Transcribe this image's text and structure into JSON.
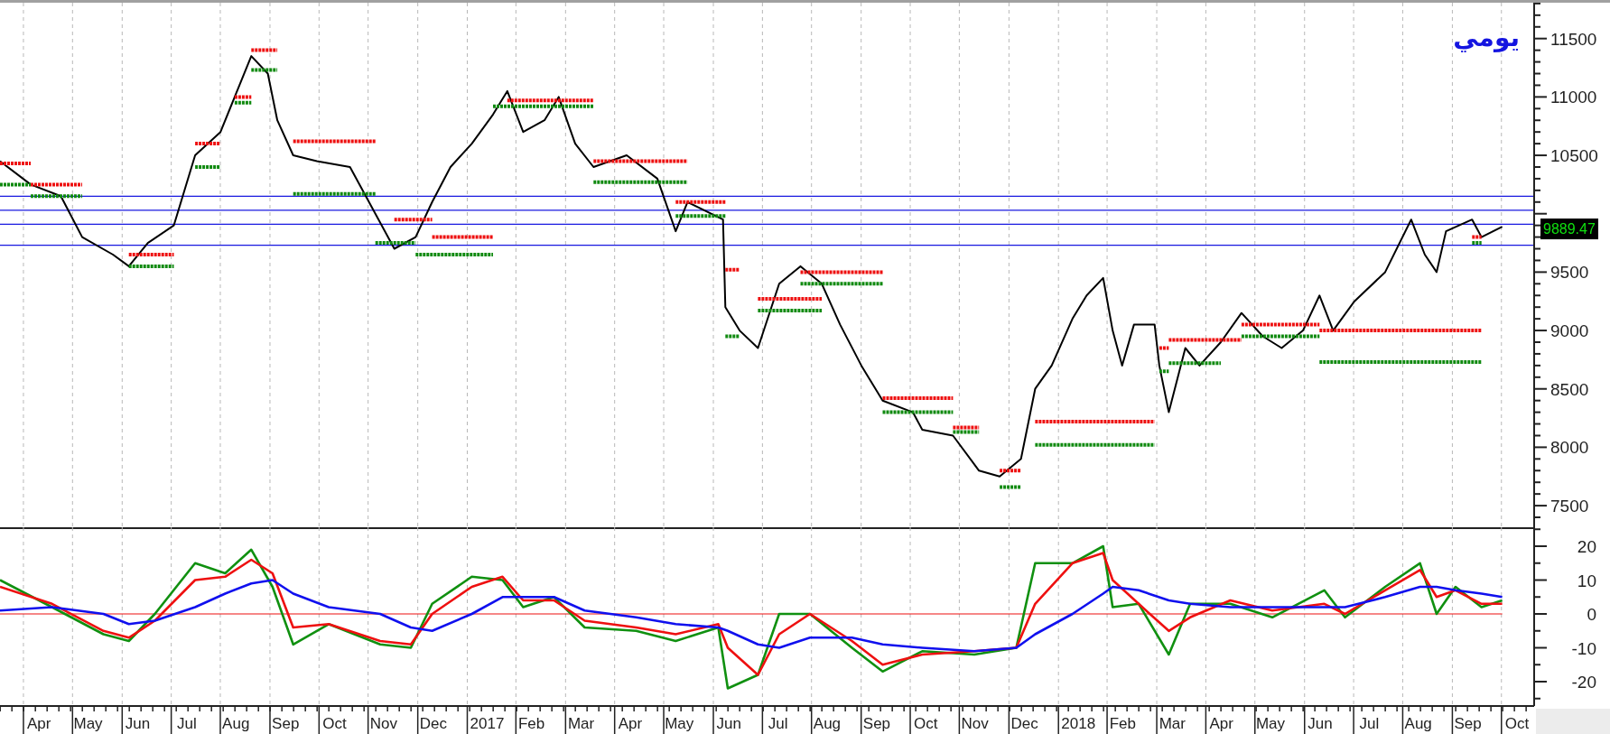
{
  "price_chart": {
    "chart_data": {
      "type": "line",
      "title": "يومي",
      "xlim": [
        2016.21,
        2018.805
      ],
      "ylim": [
        7315,
        11807
      ],
      "yticks": [
        7500,
        8000,
        8500,
        9000,
        9500,
        10500,
        11000,
        11500
      ],
      "x": [
        2016.21,
        2016.262,
        2016.313,
        2016.349,
        2016.401,
        2016.428,
        2016.46,
        2016.504,
        2016.54,
        2016.583,
        2016.607,
        2016.635,
        2016.663,
        2016.679,
        2016.706,
        2016.746,
        2016.802,
        2016.845,
        2016.877,
        2016.913,
        2016.941,
        2016.972,
        2017.008,
        2017.044,
        2017.068,
        2017.095,
        2017.131,
        2017.155,
        2017.183,
        2017.214,
        2017.27,
        2017.322,
        2017.353,
        2017.373,
        2017.433,
        2017.437,
        2017.461,
        2017.492,
        2017.528,
        2017.564,
        2017.6,
        2017.631,
        2017.667,
        2017.703,
        2017.754,
        2017.77,
        2017.822,
        2017.866,
        2017.901,
        2017.937,
        2017.961,
        2017.989,
        2018.024,
        2018.048,
        2018.076,
        2018.092,
        2018.108,
        2018.128,
        2018.163,
        2018.171,
        2018.187,
        2018.215,
        2018.239,
        2018.275,
        2018.31,
        2018.346,
        2018.378,
        2018.414,
        2018.442,
        2018.465,
        2018.501,
        2018.553,
        2018.597,
        2018.62,
        2018.64,
        2018.656,
        2018.7,
        2018.716,
        2018.751
      ],
      "series": [
        {
          "color": "#000000",
          "values": [
            10450,
            10250,
            10150,
            9800,
            9650,
            9550,
            9750,
            9900,
            10500,
            10700,
            11000,
            11350,
            11200,
            10800,
            10500,
            10450,
            10400,
            10000,
            9700,
            9800,
            10100,
            10400,
            10600,
            10850,
            11050,
            10700,
            10800,
            11000,
            10600,
            10400,
            10500,
            10300,
            9850,
            10100,
            9950,
            9200,
            9000,
            8850,
            9400,
            9550,
            9400,
            9050,
            8700,
            8400,
            8300,
            8150,
            8100,
            7800,
            7750,
            7900,
            8500,
            8700,
            9100,
            9300,
            9450,
            9000,
            8700,
            9050,
            9050,
            8700,
            8300,
            8850,
            8700,
            8900,
            9150,
            8950,
            8850,
            9000,
            9300,
            9000,
            9250,
            9500,
            9950,
            9650,
            9500,
            9850,
            9950,
            9800,
            9889
          ]
        },
        {
          "color": "#ee1010",
          "line_style": "dotted",
          "values": [
            10430,
            10430,
            null,
            null,
            null,
            9650,
            9650,
            9650,
            null,
            null,
            11000,
            11000,
            null,
            null,
            10620,
            10620,
            10620,
            10620,
            null,
            null,
            9800,
            9800,
            9800,
            9800,
            null,
            null,
            null,
            null,
            null,
            10450,
            10450,
            10450,
            10450,
            10450,
            null,
            9520,
            9520,
            null,
            null,
            9500,
            9500,
            9500,
            9500,
            9500,
            null,
            null,
            8170,
            8170,
            null,
            null,
            8220,
            8220,
            8220,
            8220,
            8220,
            8220,
            8220,
            8220,
            8220,
            null,
            8920,
            8920,
            8920,
            8920,
            8920,
            null,
            null,
            null,
            9000,
            9000,
            9000,
            9000,
            9000,
            9000,
            9000,
            9000,
            9000,
            9000,
            null
          ]
        },
        {
          "color": "#ee1010",
          "line_style": "dotted",
          "values": [
            null,
            10250,
            10250,
            10250,
            null,
            null,
            null,
            null,
            10600,
            10600,
            null,
            11400,
            11400,
            11400,
            null,
            null,
            null,
            null,
            9950,
            9950,
            9950,
            null,
            null,
            null,
            10970,
            10970,
            10970,
            10970,
            10970,
            10970,
            null,
            null,
            10100,
            10100,
            10100,
            10100,
            null,
            9270,
            9270,
            9270,
            9270,
            null,
            null,
            8420,
            8420,
            8420,
            8420,
            null,
            7800,
            7800,
            null,
            null,
            null,
            null,
            null,
            null,
            null,
            null,
            null,
            8850,
            8850,
            null,
            null,
            null,
            9050,
            9050,
            9050,
            9050,
            9050,
            null,
            null,
            null,
            null,
            null,
            null,
            null,
            9800,
            9800,
            null
          ]
        },
        {
          "color": "#108a10",
          "line_style": "dotted",
          "values": [
            10250,
            10250,
            null,
            null,
            null,
            9550,
            9550,
            9550,
            null,
            null,
            10950,
            10950,
            null,
            null,
            10170,
            10170,
            10170,
            10170,
            null,
            9650,
            9650,
            9650,
            9650,
            9650,
            null,
            null,
            null,
            null,
            null,
            10270,
            10270,
            10270,
            10270,
            10270,
            null,
            8950,
            8950,
            null,
            null,
            9400,
            9400,
            9400,
            9400,
            9400,
            null,
            null,
            8130,
            8130,
            null,
            null,
            8020,
            8020,
            8020,
            8020,
            8020,
            8020,
            8020,
            8020,
            8020,
            null,
            8720,
            8720,
            8720,
            8720,
            null,
            null,
            null,
            null,
            8730,
            8730,
            8730,
            8730,
            8730,
            8730,
            8730,
            8730,
            8730,
            8730,
            null
          ]
        },
        {
          "color": "#108a10",
          "line_style": "dotted",
          "values": [
            null,
            10150,
            10150,
            10150,
            null,
            null,
            null,
            null,
            10400,
            10400,
            null,
            11230,
            11230,
            11230,
            null,
            null,
            null,
            9750,
            9750,
            9750,
            null,
            null,
            null,
            10920,
            10920,
            10920,
            10920,
            10920,
            10920,
            10920,
            null,
            null,
            9980,
            9980,
            9980,
            9980,
            null,
            9170,
            9170,
            9170,
            9170,
            null,
            null,
            8300,
            8300,
            8300,
            8300,
            null,
            7660,
            7660,
            null,
            null,
            null,
            null,
            null,
            null,
            null,
            null,
            null,
            8650,
            8650,
            null,
            null,
            null,
            8950,
            8950,
            8950,
            8950,
            8950,
            null,
            null,
            null,
            null,
            null,
            null,
            null,
            9750,
            9750,
            null
          ]
        }
      ],
      "ref_lines": [
        {
          "axis": "y",
          "value": 10150,
          "color": "#1818e0"
        },
        {
          "axis": "y",
          "value": 10030,
          "color": "#1818e0"
        },
        {
          "axis": "y",
          "value": 9910,
          "color": "#1818e0"
        },
        {
          "axis": "y",
          "value": 9730,
          "color": "#1818e0"
        }
      ],
      "annotations": [
        "9889.47"
      ]
    }
  },
  "indicator_chart": {
    "chart_data": {
      "type": "line",
      "xlim": [
        2016.21,
        2018.805
      ],
      "ylim": [
        -27.2,
        25.6
      ],
      "yticks": [
        -20,
        -10,
        0,
        10,
        20
      ],
      "xticks": [
        {
          "value": 2016.276,
          "label": "Apr"
        },
        {
          "value": 2016.359,
          "label": "May"
        },
        {
          "value": 2016.443,
          "label": "Jun"
        },
        {
          "value": 2016.526,
          "label": "Jul"
        },
        {
          "value": 2016.609,
          "label": "Aug"
        },
        {
          "value": 2016.693,
          "label": "Sep"
        },
        {
          "value": 2016.776,
          "label": "Oct"
        },
        {
          "value": 2016.859,
          "label": "Nov"
        },
        {
          "value": 2016.943,
          "label": "Dec"
        },
        {
          "value": 2017.034,
          "label": "2017"
        },
        {
          "value": 2017.109,
          "label": "Feb"
        },
        {
          "value": 2017.193,
          "label": "Mar"
        },
        {
          "value": 2017.276,
          "label": "Apr"
        },
        {
          "value": 2017.359,
          "label": "May"
        },
        {
          "value": 2017.443,
          "label": "Jun"
        },
        {
          "value": 2017.526,
          "label": "Jul"
        },
        {
          "value": 2017.609,
          "label": "Aug"
        },
        {
          "value": 2017.693,
          "label": "Sep"
        },
        {
          "value": 2017.776,
          "label": "Oct"
        },
        {
          "value": 2017.859,
          "label": "Nov"
        },
        {
          "value": 2017.943,
          "label": "Dec"
        },
        {
          "value": 2018.034,
          "label": "2018"
        },
        {
          "value": 2018.109,
          "label": "Feb"
        },
        {
          "value": 2018.193,
          "label": "Mar"
        },
        {
          "value": 2018.276,
          "label": "Apr"
        },
        {
          "value": 2018.359,
          "label": "May"
        },
        {
          "value": 2018.443,
          "label": "Jun"
        },
        {
          "value": 2018.526,
          "label": "Jul"
        },
        {
          "value": 2018.609,
          "label": "Aug"
        },
        {
          "value": 2018.693,
          "label": "Sep"
        },
        {
          "value": 2018.776,
          "label": "Oct"
        }
      ],
      "x": [
        2016.21,
        2016.298,
        2016.385,
        2016.428,
        2016.472,
        2016.54,
        2016.591,
        2016.635,
        2016.671,
        2016.706,
        2016.766,
        2016.853,
        2016.905,
        2016.941,
        2017.008,
        2017.06,
        2017.095,
        2017.147,
        2017.199,
        2017.286,
        2017.353,
        2017.425,
        2017.441,
        2017.492,
        2017.528,
        2017.58,
        2017.651,
        2017.703,
        2017.77,
        2017.858,
        2017.929,
        2017.961,
        2018.024,
        2018.076,
        2018.092,
        2018.136,
        2018.187,
        2018.223,
        2018.291,
        2018.362,
        2018.45,
        2018.485,
        2018.553,
        2018.612,
        2018.64,
        2018.672,
        2018.716,
        2018.751
      ],
      "series": [
        {
          "color": "#109010",
          "values": [
            10,
            2,
            -6,
            -8,
            0,
            15,
            12,
            19,
            8,
            -9,
            -3,
            -9,
            -10,
            3,
            11,
            10,
            2,
            5,
            -4,
            -5,
            -8,
            -4,
            -22,
            -18,
            0,
            0,
            -10,
            -17,
            -11,
            -12,
            -10,
            15,
            15,
            20,
            2,
            3,
            -12,
            3,
            3,
            -1,
            7,
            -1,
            8,
            15,
            0,
            8,
            2,
            4
          ]
        },
        {
          "color": "#ee1010",
          "values": [
            8,
            3,
            -5,
            -7,
            -2,
            10,
            11,
            16,
            12,
            -4,
            -3,
            -8,
            -9,
            0,
            8,
            11,
            4,
            4,
            -2,
            -4,
            -6,
            -3,
            -10,
            -18,
            -6,
            0,
            -8,
            -15,
            -12,
            -11,
            -10,
            3,
            15,
            18,
            10,
            3,
            -5,
            -1,
            4,
            1,
            3,
            0,
            7,
            13,
            5,
            7,
            3,
            3
          ]
        },
        {
          "color": "#1010ee",
          "values": [
            1,
            2,
            0,
            -3,
            -2,
            2,
            6,
            9,
            10,
            6,
            2,
            0,
            -4,
            -5,
            0,
            5,
            5,
            5,
            1,
            -1,
            -3,
            -4,
            -5,
            -9,
            -10,
            -7,
            -7,
            -9,
            -10,
            -11,
            -10,
            -6,
            0,
            6,
            8,
            7,
            4,
            3,
            2,
            2,
            2,
            2,
            5,
            8,
            8,
            7,
            6,
            5
          ]
        }
      ],
      "ref_lines": [
        {
          "axis": "y",
          "value": 0,
          "color": "#ee1010"
        }
      ]
    }
  }
}
